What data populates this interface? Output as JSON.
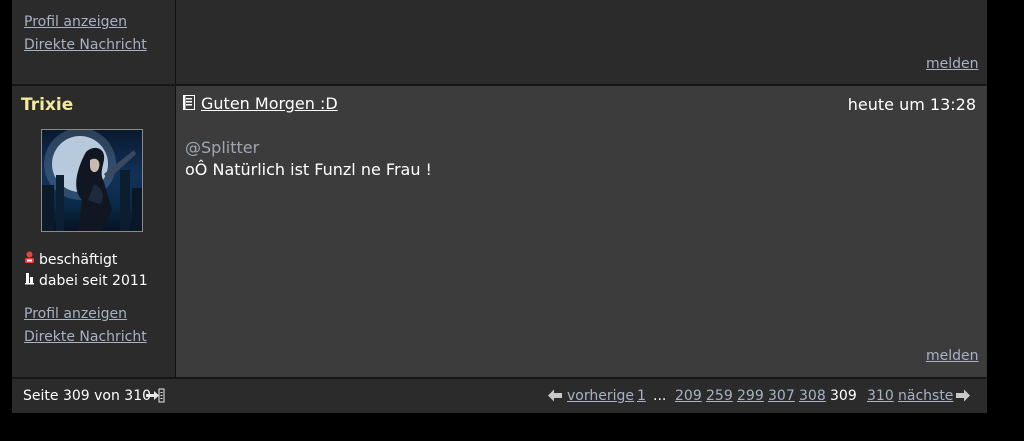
{
  "prev_post": {
    "profile_label": "Profil anzeigen",
    "message_label": "Direkte Nachricht",
    "report_label": "melden"
  },
  "post": {
    "author": "Trixie",
    "status": "beschäftigt",
    "member_since": "dabei seit 2011",
    "profile_label": "Profil anzeigen",
    "message_label": "Direkte Nachricht",
    "title": "Guten Morgen :D",
    "time": "heute um 13:28",
    "quote_mention": "@Splitter",
    "text": "oÔ Natürlich ist Funzl ne Frau !",
    "report_label": "melden"
  },
  "pagination": {
    "page_info": "Seite 309 von 310",
    "prev_label": "vorherige",
    "first": "1",
    "ellipsis": "...",
    "pages": [
      "209",
      "259",
      "299",
      "307",
      "308"
    ],
    "current": "309",
    "last": "310",
    "next_label": "nächste"
  },
  "colors": {
    "background": "#000000",
    "panel": "#2b2b2b",
    "content": "#3c3c3c",
    "author": "#f1e99b",
    "link": "#a8b2c4",
    "quote": "#a0a6b3"
  },
  "icons": {
    "status": "busy-icon",
    "member": "member-since-icon",
    "title": "document-icon",
    "jump": "jump-to-page-icon",
    "prev": "arrow-left-icon",
    "next": "arrow-right-icon"
  }
}
